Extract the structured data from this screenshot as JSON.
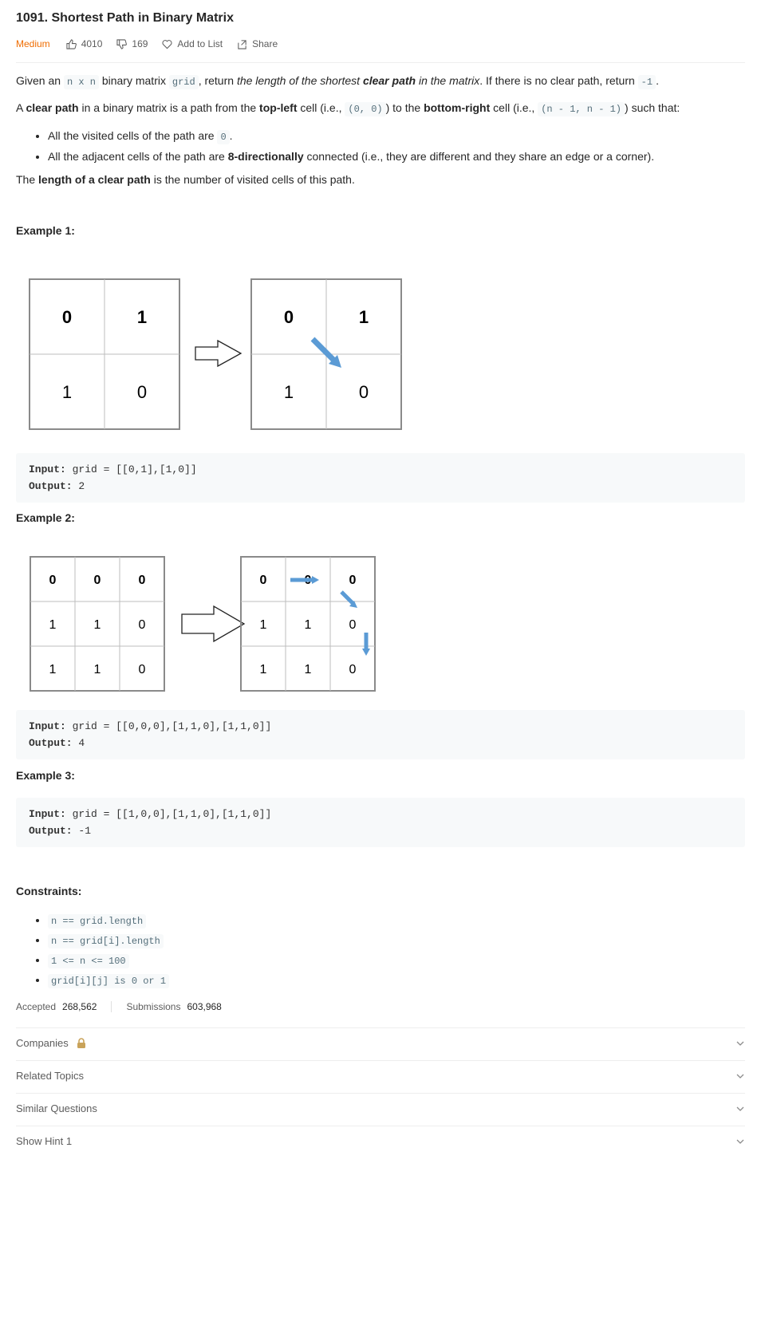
{
  "problem": {
    "title": "1091. Shortest Path in Binary Matrix",
    "difficulty": "Medium",
    "likes": "4010",
    "dislikes": "169",
    "add_to_list": "Add to List",
    "share": "Share"
  },
  "description": {
    "p1": {
      "t1": "Given an ",
      "c1": "n x n",
      "t2": " binary matrix ",
      "c2": "grid",
      "t3": ", return ",
      "em1": "the length of the shortest ",
      "em_bold": "clear path",
      "em2": " in the matrix",
      "t4": ". If there is no clear path, return ",
      "c3": "-1",
      "t5": "."
    },
    "p2": {
      "t1": "A ",
      "b1": "clear path",
      "t2": " in a binary matrix is a path from the ",
      "b2": "top-left",
      "t3": " cell (i.e., ",
      "c1": "(0, 0)",
      "t4": ") to the ",
      "b3": "bottom-right",
      "t5": " cell (i.e., ",
      "c2": "(n - 1, n - 1)",
      "t6": ") such that:"
    },
    "bullets": [
      {
        "t1": "All the visited cells of the path are ",
        "c1": "0",
        "t2": "."
      },
      {
        "t1": "All the adjacent cells of the path are ",
        "b1": "8-directionally",
        "t2": " connected (i.e., they are different and they share an edge or a corner)."
      }
    ],
    "p3": {
      "t1": "The ",
      "b1": "length of a clear path",
      "t2": " is the number of visited cells of this path."
    }
  },
  "examples": [
    {
      "heading": "Example 1:",
      "input_label": "Input:",
      "input": " grid = [[0,1],[1,0]]",
      "output_label": "Output:",
      "output": " 2",
      "grid": [
        [
          "0",
          "1"
        ],
        [
          "1",
          "0"
        ]
      ]
    },
    {
      "heading": "Example 2:",
      "input_label": "Input:",
      "input": " grid = [[0,0,0],[1,1,0],[1,1,0]]",
      "output_label": "Output:",
      "output": " 4",
      "grid": [
        [
          "0",
          "0",
          "0"
        ],
        [
          "1",
          "1",
          "0"
        ],
        [
          "1",
          "1",
          "0"
        ]
      ]
    },
    {
      "heading": "Example 3:",
      "input_label": "Input:",
      "input": " grid = [[1,0,0],[1,1,0],[1,1,0]]",
      "output_label": "Output:",
      "output": " -1"
    }
  ],
  "constraints": {
    "heading": "Constraints:",
    "items": [
      "n == grid.length",
      "n == grid[i].length",
      "1 <= n <= 100",
      "grid[i][j] is 0 or 1"
    ]
  },
  "stats": {
    "accepted_label": "Accepted",
    "accepted": "268,562",
    "submissions_label": "Submissions",
    "submissions": "603,968"
  },
  "sections": [
    "Companies",
    "Related Topics",
    "Similar Questions",
    "Show Hint 1"
  ],
  "colors": {
    "difficulty": "#ef6c00",
    "arrow": "#5b9bd5",
    "lock": "#c9a35a"
  },
  "icons": [
    "thumbs-up-icon",
    "thumbs-down-icon",
    "heart-icon",
    "share-icon",
    "lock-icon",
    "chevron-down-icon"
  ]
}
